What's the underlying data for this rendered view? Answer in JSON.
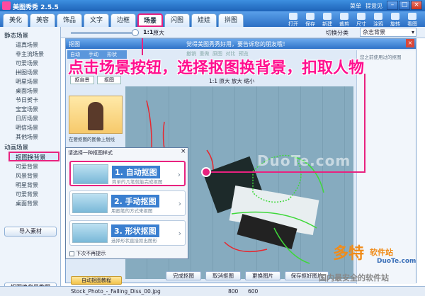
{
  "app": {
    "title": "美图秀秀 2.5.5",
    "menu": [
      "菜单",
      "提意见"
    ]
  },
  "window_controls": [
    "minimize",
    "maximize",
    "close"
  ],
  "tabs": [
    {
      "label": "美化"
    },
    {
      "label": "美容"
    },
    {
      "label": "饰品"
    },
    {
      "label": "文字"
    },
    {
      "label": "边框"
    },
    {
      "label": "场景",
      "selected": true
    },
    {
      "label": "闪图"
    },
    {
      "label": "娃娃"
    },
    {
      "label": "拼图"
    }
  ],
  "toolbar_buttons": [
    "打开",
    "保存",
    "新建",
    "裁剪",
    "尺寸",
    "涂鸦",
    "旋转",
    "看图"
  ],
  "zoom": {
    "label": "原大",
    "ratio": "1:1"
  },
  "category": {
    "label": "切换分类",
    "value": "杂志背景"
  },
  "left_panel": {
    "static_header": "静态场景",
    "static_items": [
      "逼真场景",
      "非主流场景",
      "可爱场景",
      "拼图场景",
      "明星场景",
      "桌面场景",
      "节日贺卡",
      "宝宝场景",
      "日历场景",
      "明信场景",
      "其他场景"
    ],
    "anim_header": "动画场景",
    "cutout_header": "抠图换背景",
    "cutout_items": [
      "可爱背景",
      "风景背景",
      "明星背景",
      "可爱背景",
      "桌面背景"
    ],
    "import_button": "导入素材",
    "tutorial_button": "抠图换背景教程"
  },
  "editor": {
    "title": "抠图",
    "subtitle": "觉得美图秀秀好用，要告诉您的朋友哦！",
    "side_tabs": [
      "自动",
      "手动",
      "形状"
    ],
    "side_buttons": [
      "抠自景",
      "抠图"
    ],
    "undo_labels": [
      "撤销",
      "重做",
      "原图",
      "对比",
      "预览"
    ],
    "toolrow": {
      "zoom": "1:1",
      "actual": "原大",
      "zoom_in": "放大",
      "zoom_out": "缩小"
    },
    "hint": "在要抠图的图像上划线",
    "right_label": "您之前使用过的抠图"
  },
  "dialog": {
    "title": "请选择一种抠图样式",
    "options": [
      {
        "name": "1. 自动抠图",
        "desc": "简单的几笔就能完成抠图"
      },
      {
        "name": "2. 手动抠图",
        "desc": "用画笔的方式来抠图"
      },
      {
        "name": "3. 形状抠图",
        "desc": "选择形状直接抠出图形"
      }
    ],
    "checkbox": "下次不再提示",
    "bottom_button": "自动抠图教程"
  },
  "bottom_buttons": [
    "完成抠图",
    "取消抠图",
    "更换图片",
    "保存抠好图片"
  ],
  "status": {
    "filename": "Stock_Photo_-_Falling_Diss_00.jpg",
    "width": "800",
    "height": "600"
  },
  "annotation": {
    "caption": "点击场景按钮，选择抠图换背景，扣取人物"
  },
  "watermark": {
    "brand": "多特",
    "sub": "软件站",
    "slogan": "国内最安全的软件站",
    "url": "DuoTe.com"
  },
  "colors": {
    "accent": "#e8227f",
    "title_blue": "#2c6fc4",
    "caption": "#ff0f8f"
  }
}
